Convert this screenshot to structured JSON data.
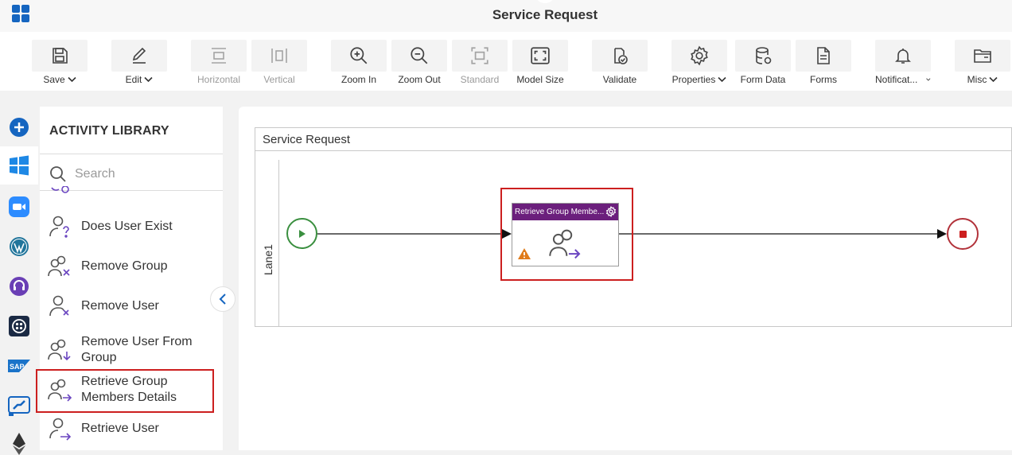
{
  "header": {
    "title": "Service Request"
  },
  "toolbar": {
    "save": "Save",
    "edit": "Edit",
    "horizontal": "Horizontal",
    "vertical": "Vertical",
    "zoom_in": "Zoom In",
    "zoom_out": "Zoom Out",
    "standard": "Standard",
    "model_size": "Model Size",
    "validate": "Validate",
    "properties": "Properties",
    "form_data": "Form Data",
    "forms": "Forms",
    "notifications": "Notificat...",
    "misc": "Misc"
  },
  "sidebar": {
    "icons": [
      "add-icon",
      "windows-icon",
      "zoom-icon",
      "wordpress-icon",
      "support-headset-icon",
      "twilio-icon",
      "sap-icon",
      "power-automate-icon",
      "ethereum-icon"
    ]
  },
  "library": {
    "title": "ACTIVITY LIBRARY",
    "search_placeholder": "Search",
    "items": [
      {
        "label": "Does User Exist"
      },
      {
        "label": "Remove Group"
      },
      {
        "label": "Remove User"
      },
      {
        "label": "Remove User From Group"
      },
      {
        "label": "Retrieve Group Members Details"
      },
      {
        "label": "Retrieve User"
      }
    ]
  },
  "canvas": {
    "pool_title": "Service Request",
    "lane_label": "Lane1",
    "activity_title": "Retrieve Group Membe..."
  },
  "colors": {
    "activity_header": "#6b1f7c",
    "highlight": "#cc1f1f",
    "start": "#3a8f3f",
    "end": "#b2323a",
    "accent_icon": "#6b46c1"
  }
}
